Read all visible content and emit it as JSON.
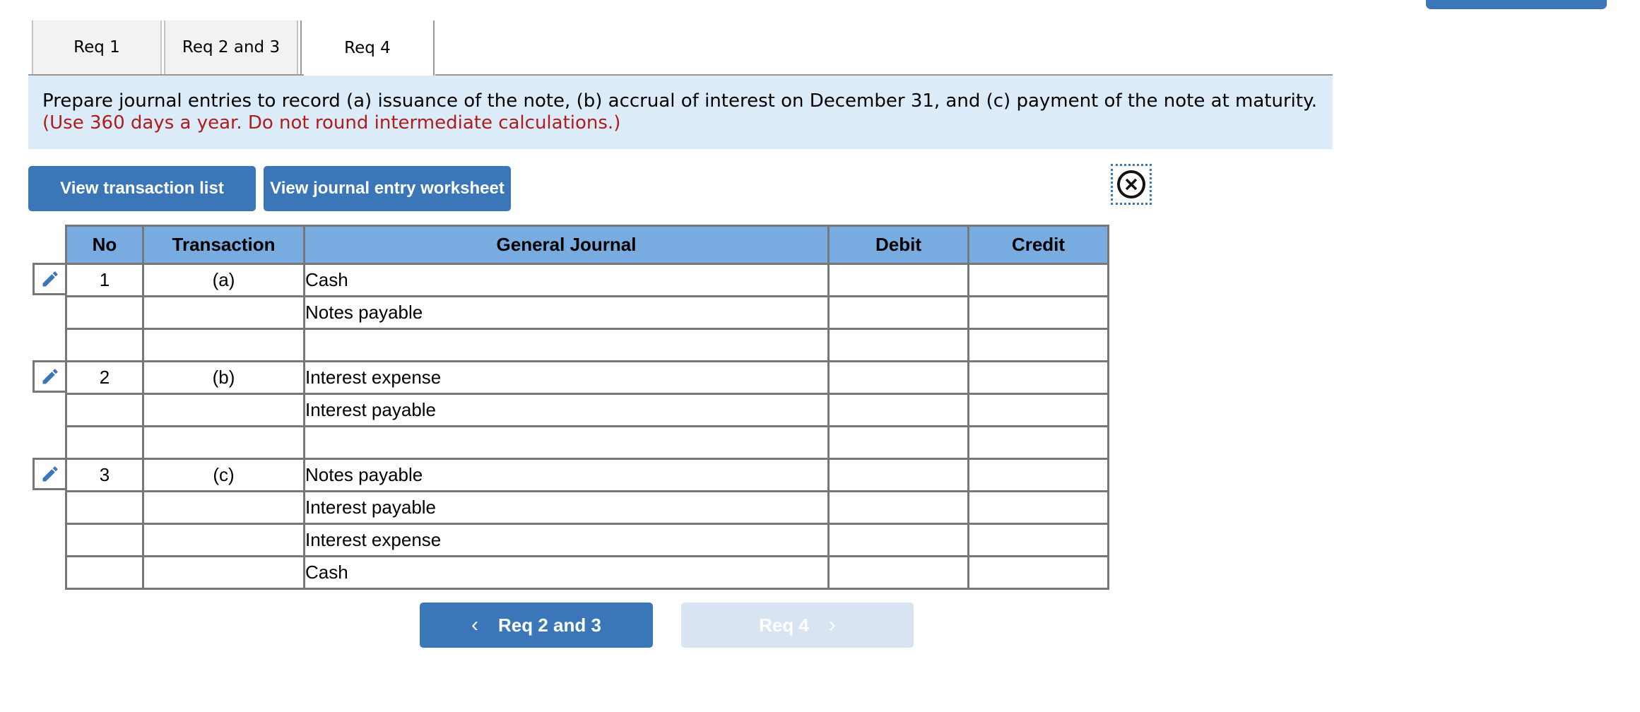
{
  "tabs": [
    {
      "label": "Req 1",
      "active": false
    },
    {
      "label": "Req 2 and 3",
      "active": false
    },
    {
      "label": "Req 4",
      "active": true
    }
  ],
  "instructions": {
    "main": "Prepare journal entries to record (a) issuance of the note, (b) accrual of interest on December 31, and (c) payment of the note at maturity.",
    "note": "(Use 360 days a year. Do not round intermediate calculations.)"
  },
  "toolbar": {
    "view_transaction_list": "View transaction list",
    "view_journal_entry_worksheet": "View journal entry worksheet"
  },
  "close_icon": "close-circle-icon",
  "table": {
    "headers": {
      "no": "No",
      "transaction": "Transaction",
      "general_journal": "General Journal",
      "debit": "Debit",
      "credit": "Credit"
    },
    "rows": [
      {
        "no": "1",
        "transaction": "(a)",
        "account": "Cash",
        "debit": "",
        "credit": ""
      },
      {
        "no": "",
        "transaction": "",
        "account": "Notes payable",
        "debit": "",
        "credit": ""
      },
      {
        "no": "",
        "transaction": "",
        "account": "",
        "debit": "",
        "credit": ""
      },
      {
        "no": "2",
        "transaction": "(b)",
        "account": "Interest expense",
        "debit": "",
        "credit": ""
      },
      {
        "no": "",
        "transaction": "",
        "account": "Interest payable",
        "debit": "",
        "credit": ""
      },
      {
        "no": "",
        "transaction": "",
        "account": "",
        "debit": "",
        "credit": ""
      },
      {
        "no": "3",
        "transaction": "(c)",
        "account": "Notes payable",
        "debit": "",
        "credit": ""
      },
      {
        "no": "",
        "transaction": "",
        "account": "Interest payable",
        "debit": "",
        "credit": ""
      },
      {
        "no": "",
        "transaction": "",
        "account": "Interest expense",
        "debit": "",
        "credit": ""
      },
      {
        "no": "",
        "transaction": "",
        "account": "Cash",
        "debit": "",
        "credit": ""
      }
    ]
  },
  "navigation": {
    "prev_label": "Req 2 and 3",
    "prev_icon": "‹",
    "next_label": "Req 4",
    "next_icon": "›",
    "next_disabled": true
  },
  "colors": {
    "accent": "#3a76b8",
    "header": "#78ace0",
    "info_bg": "#dbebf8",
    "note_red": "#b01c1c",
    "disabled": "#d8e4f1"
  }
}
